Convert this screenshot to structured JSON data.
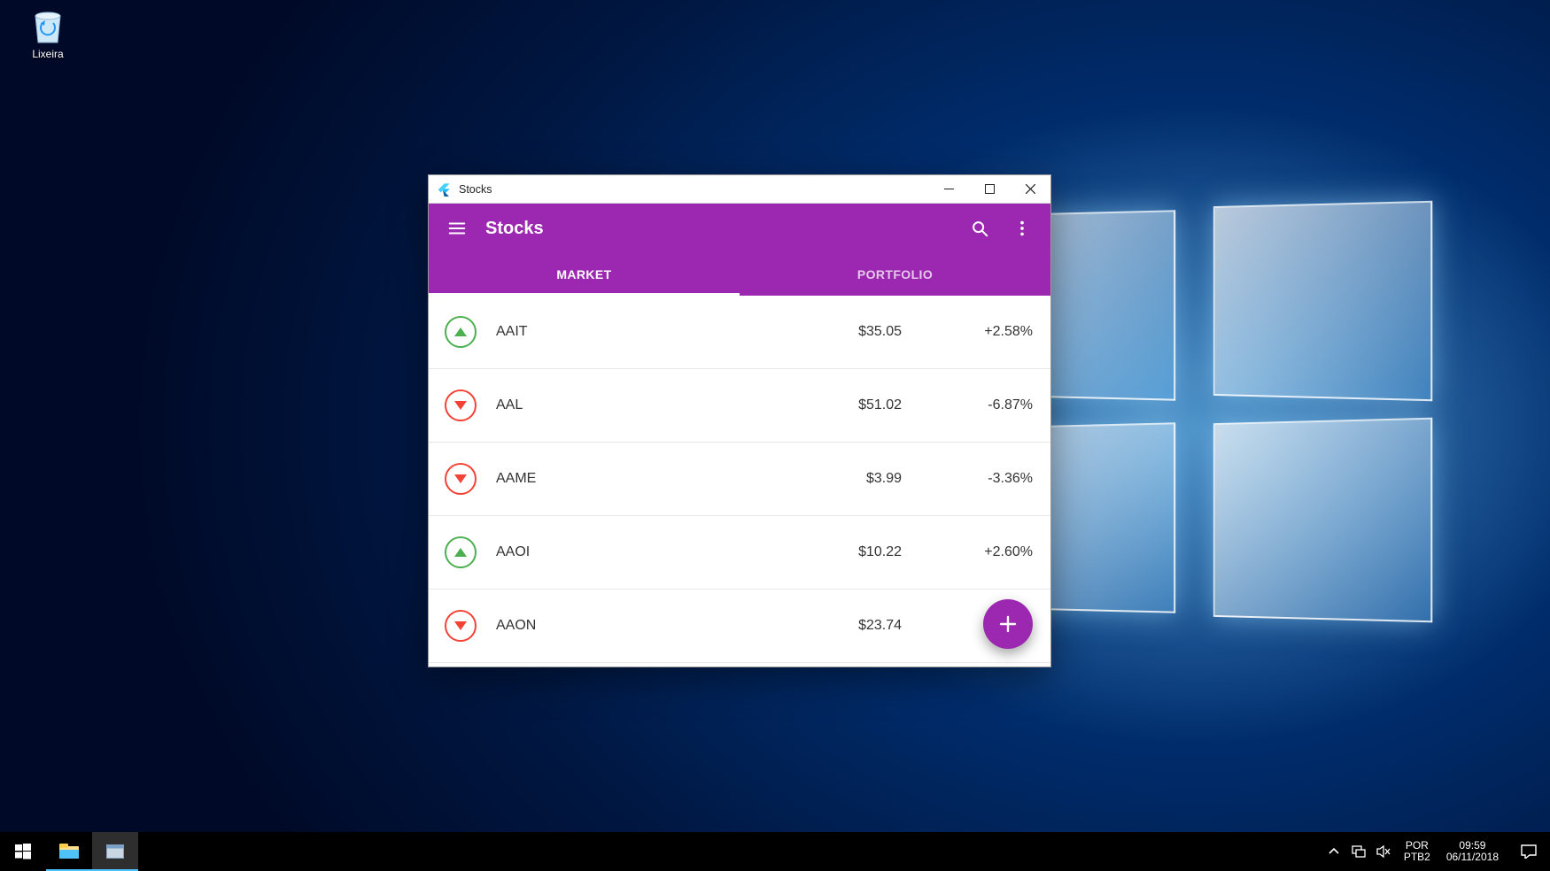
{
  "desktop": {
    "recycle_bin_label": "Lixeira"
  },
  "taskbar": {
    "lang_line1": "POR",
    "lang_line2": "PTB2",
    "time": "09:59",
    "date": "06/11/2018"
  },
  "window": {
    "title": "Stocks"
  },
  "app": {
    "title": "Stocks",
    "tabs": {
      "market": "MARKET",
      "portfolio": "PORTFOLIO"
    },
    "stocks": [
      {
        "symbol": "AAIT",
        "price": "$35.05",
        "change": "+2.58%",
        "dir": "up"
      },
      {
        "symbol": "AAL",
        "price": "$51.02",
        "change": "-6.87%",
        "dir": "down"
      },
      {
        "symbol": "AAME",
        "price": "$3.99",
        "change": "-3.36%",
        "dir": "down"
      },
      {
        "symbol": "AAOI",
        "price": "$10.22",
        "change": "+2.60%",
        "dir": "up"
      },
      {
        "symbol": "AAON",
        "price": "$23.74",
        "change": "",
        "dir": "down"
      }
    ]
  }
}
